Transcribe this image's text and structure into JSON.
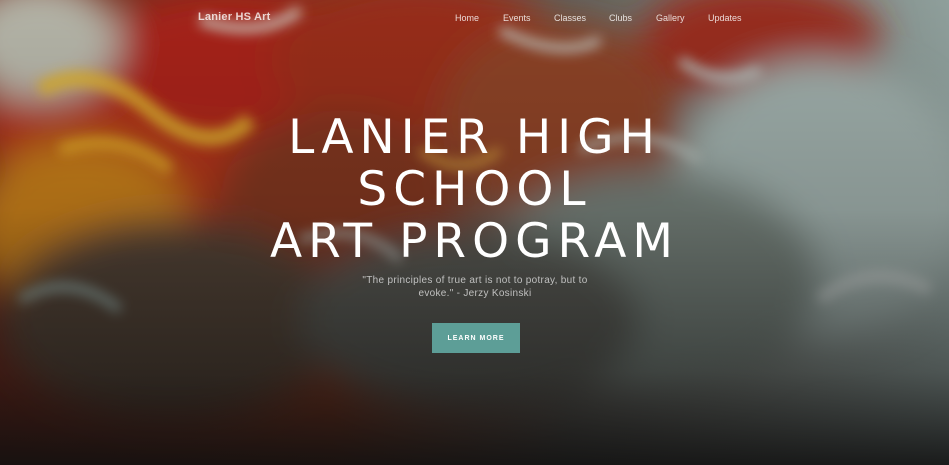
{
  "navbar": {
    "brand": "Lanier HS Art",
    "links": [
      "Home",
      "Events",
      "Classes",
      "Clubs",
      "Gallery",
      "Updates"
    ]
  },
  "hero": {
    "title_lines": [
      "LANIER HIGH",
      "SCHOOL",
      "ART PROGRAM"
    ],
    "quote_lines": [
      "\"The principles of true art is not to potray, but to",
      "evoke.\" - Jerzy Kosinski"
    ],
    "cta_label": "LEARN MORE",
    "background": "abstract oil painting with red, orange and yellow brush strokes fading into pale teal and grey"
  },
  "colors": {
    "cta": "#5d9e97",
    "title": "#ffffff"
  }
}
